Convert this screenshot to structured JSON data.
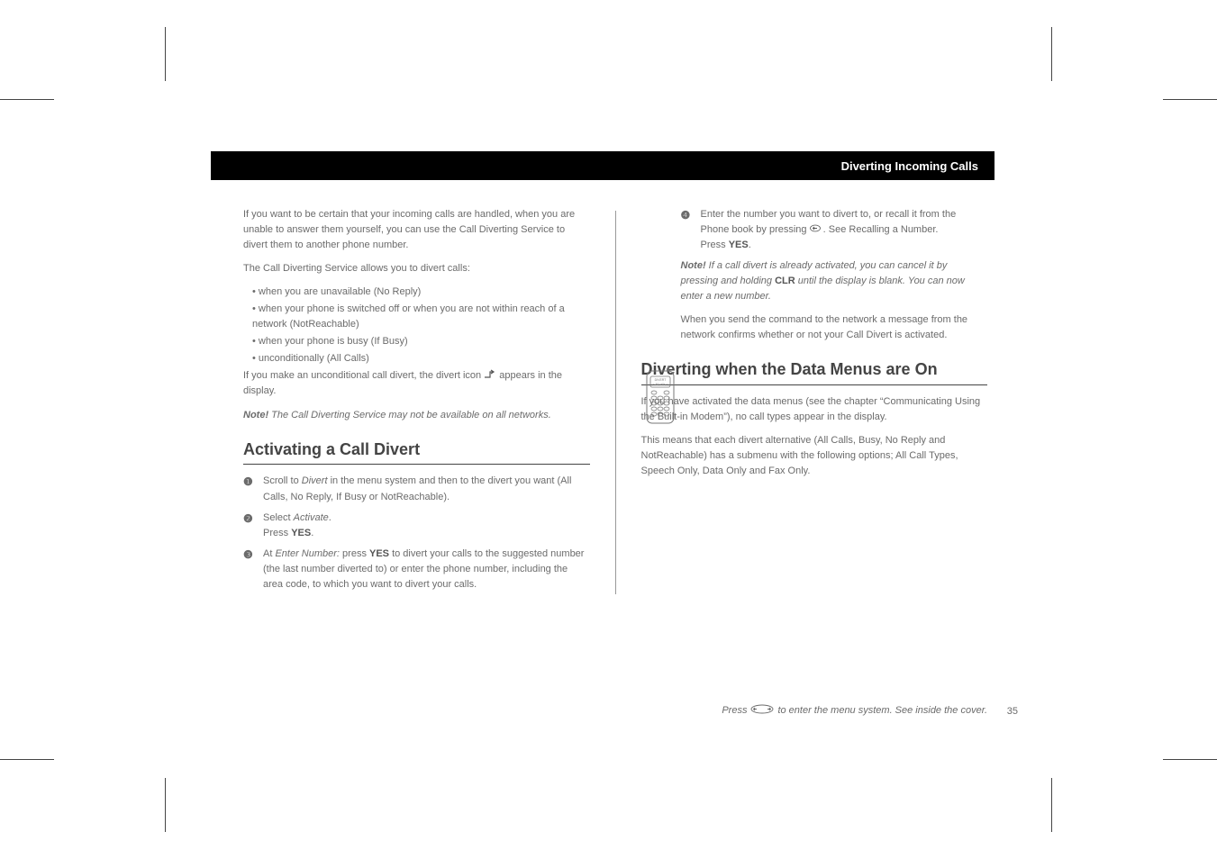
{
  "header": {
    "title": "Diverting Incoming Calls"
  },
  "left": {
    "intro1": "If you want to be certain that your incoming calls are handled, when you are unable to answer them yourself, you can use the Call Diverting Service to divert them to another phone number.",
    "intro2": "The Call Diverting Service allows you to divert calls:",
    "bullets": [
      "when you are unavailable (No Reply)",
      "when your phone is switched off or when you are not within reach of a network (NotReachable)",
      "when your phone is busy (If Busy)",
      "unconditionally (All Calls)"
    ],
    "intro3_a": "If you make an unconditional call divert, the divert icon ",
    "intro3_b": " appears in the display.",
    "note1_label": "Note!",
    "note1_body": " The Call Diverting Service may not be available on all networks.",
    "h_activate": "Activating a Call Divert",
    "steps": [
      {
        "n": "❶",
        "body_a": "Scroll to ",
        "i": "Divert",
        "body_b": " in the menu system and then to the divert you want (All Calls, No Reply, If Busy or NotReachable)."
      },
      {
        "n": "❷",
        "body_a": "Select ",
        "i": "Activate",
        "body_b": ".\nPress ",
        "bold": "YES",
        "body_c": "."
      },
      {
        "n": "❸",
        "body_a": "At ",
        "i": "Enter Number:",
        "body_b": " press ",
        "bold": "YES",
        "body_c": " to divert your calls to the suggested number (the last number diverted to) or enter the phone number, including the area code, to which you want to divert your calls."
      }
    ]
  },
  "right": {
    "step4": {
      "n": "❹",
      "body_a": "Enter the number you want to divert to, or recall it from the Phone book by pressing ",
      "arrow": true,
      "body_b": ". See Recalling a Number.\nPress ",
      "bold": "YES",
      "body_c": "."
    },
    "note2_label": "Note!",
    "note2_body_a": " If a call divert is already activated, you can cancel it by pressing and holding ",
    "note2_bold": "CLR",
    "note2_body_b": " until the display is blank. You can now enter a new number.",
    "callout": "When you send the command to the network  a message from the network confirms whether or not your Call Divert is activated.",
    "h_divert_data": "Diverting when the Data Menus are On",
    "data1": "If you have activated the data menus (see the chapter “Communicating Using the Built-in Modem”), no call types appear in the display.",
    "data2": "This means that each divert alternative (All Calls, Busy, No Reply and NotReachable) has a submenu with the following options; All Call Types, Speech Only, Data Only and Fax Only.",
    "phone_screen1": "DIVERT",
    "phone_screen2": "< All calls >"
  },
  "footer": {
    "press": "Press ",
    "rest": " to enter the menu system. See inside the cover.",
    "page": "35"
  }
}
